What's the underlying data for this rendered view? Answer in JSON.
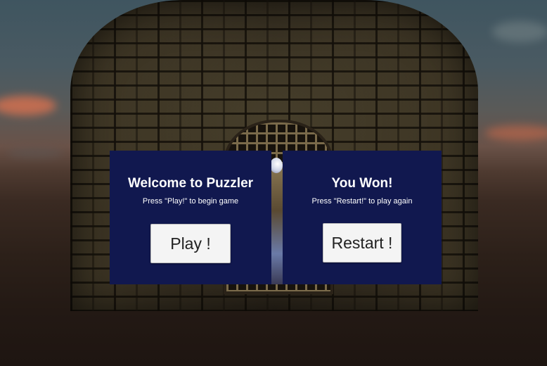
{
  "welcome_panel": {
    "title": "Welcome to Puzzler",
    "subtitle": "Press \"Play!\" to begin game",
    "button_label": "Play !"
  },
  "won_panel": {
    "title": "You Won!",
    "subtitle": "Press \"Restart!\" to play  again",
    "button_label": "Restart !"
  },
  "colors": {
    "panel_background": "#11184f",
    "panel_text": "#ffffff",
    "button_background": "#f4f4f4",
    "sky_top": "#3f5560",
    "sunset_cloud": "#e0704a"
  },
  "icons": [
    "stone-tower",
    "portcullis-gate",
    "white-orb"
  ]
}
